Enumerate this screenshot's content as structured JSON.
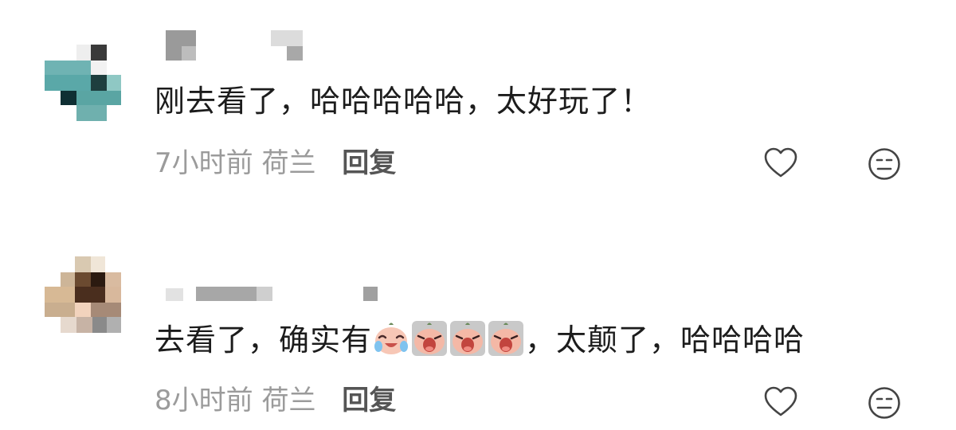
{
  "comments": [
    {
      "text_before": "刚去看了，哈哈哈哈哈，太好玩了！",
      "text_after": "",
      "time": "7小时前",
      "location": "荷兰",
      "reply_label": "回复",
      "emojis": []
    },
    {
      "text_before": "去看了，确实有",
      "text_after": "，太颠了，哈哈哈哈",
      "time": "8小时前",
      "location": "荷兰",
      "reply_label": "回复",
      "emojis": [
        "crying-laugh-emoji",
        "wailing-emoji",
        "wailing-emoji",
        "wailing-emoji"
      ]
    }
  ],
  "icons": {
    "like": "heart-icon",
    "react": "neutral-face-icon"
  },
  "colors": {
    "text": "#1c1c1c",
    "meta": "#9b9b9b",
    "reply": "#555555",
    "icon": "#444444"
  }
}
